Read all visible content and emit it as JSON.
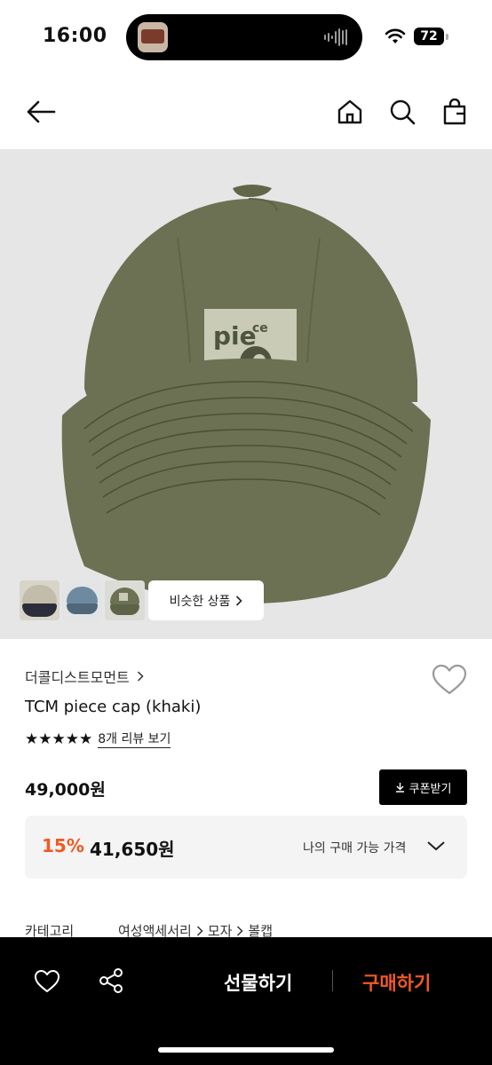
{
  "status": {
    "time": "16:00",
    "battery": "72"
  },
  "nav": {
    "back_icon": "arrow-left-icon",
    "home_icon": "home-icon",
    "search_icon": "search-icon",
    "bag_icon": "shopping-bag-icon"
  },
  "hero": {
    "similar_label": "비슷한 상품"
  },
  "product": {
    "brand": "더콜디스트모먼트",
    "name": "TCM piece cap (khaki)",
    "rating_stars": "★★★★★",
    "reviews_label": "8개 리뷰 보기",
    "price": "49,000원",
    "coupon_label": "쿠폰받기",
    "discount_pct": "15%",
    "discount_price": "41,650원",
    "my_price_label": "나의 구매 가능 가격",
    "category_label": "카테고리",
    "category_path": [
      "여성액세서리",
      "모자",
      "볼캡"
    ]
  },
  "bottom": {
    "gift_label": "선물하기",
    "buy_label": "구매하기"
  },
  "colors": {
    "accent": "#f05a23",
    "cap": "#6b7152",
    "hero_bg": "#e6e6e6"
  }
}
